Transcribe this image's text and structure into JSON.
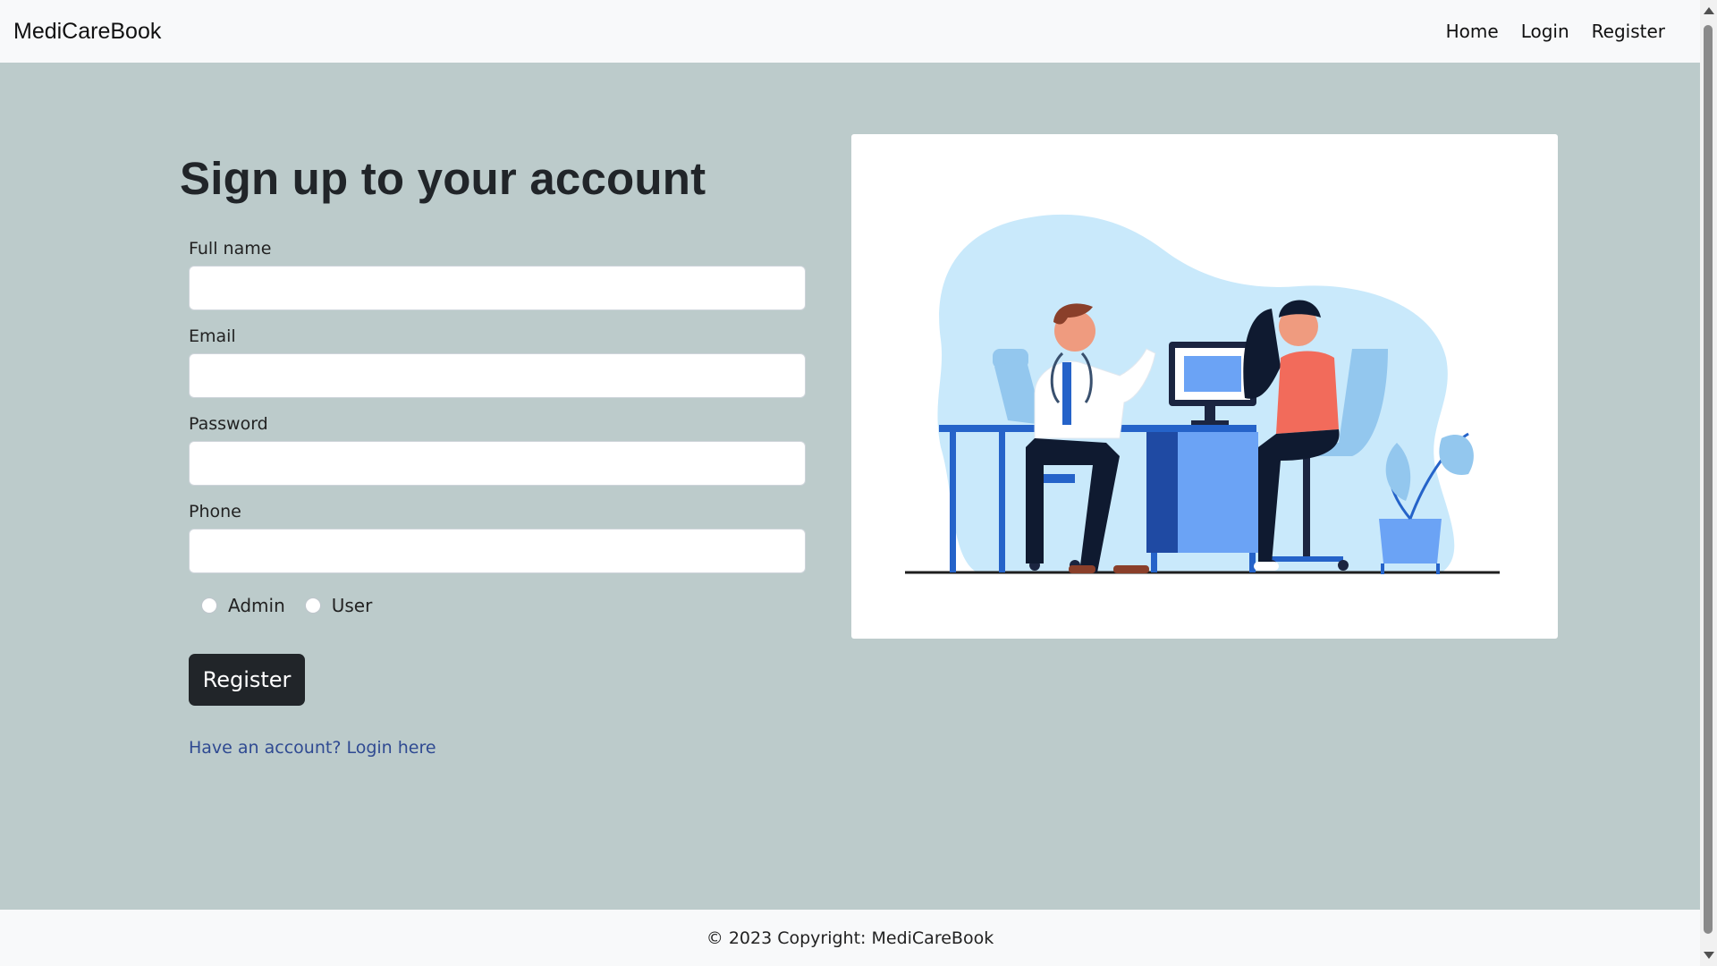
{
  "navbar": {
    "brand": "MediCareBook",
    "links": [
      {
        "label": "Home"
      },
      {
        "label": "Login"
      },
      {
        "label": "Register"
      }
    ]
  },
  "form": {
    "title": "Sign up to your account",
    "fields": [
      {
        "label": "Full name",
        "value": ""
      },
      {
        "label": "Email",
        "value": ""
      },
      {
        "label": "Password",
        "value": ""
      },
      {
        "label": "Phone",
        "value": ""
      }
    ],
    "roles": [
      {
        "label": "Admin",
        "checked": false
      },
      {
        "label": "User",
        "checked": false
      }
    ],
    "submit_label": "Register",
    "login_link": "Have an account? Login here"
  },
  "footer": {
    "text": "© 2023 Copyright: MediCareBook"
  },
  "colors": {
    "page_bg": "#bccbcb",
    "navbar_bg": "#f8f9fa",
    "button_bg": "#212529",
    "link": "#2f4a92",
    "illus_blob": "#c9e9fb",
    "illus_blue": "#2563c9"
  },
  "illustration": {
    "description_icon": "doctor-patient-consultation-illustration"
  }
}
